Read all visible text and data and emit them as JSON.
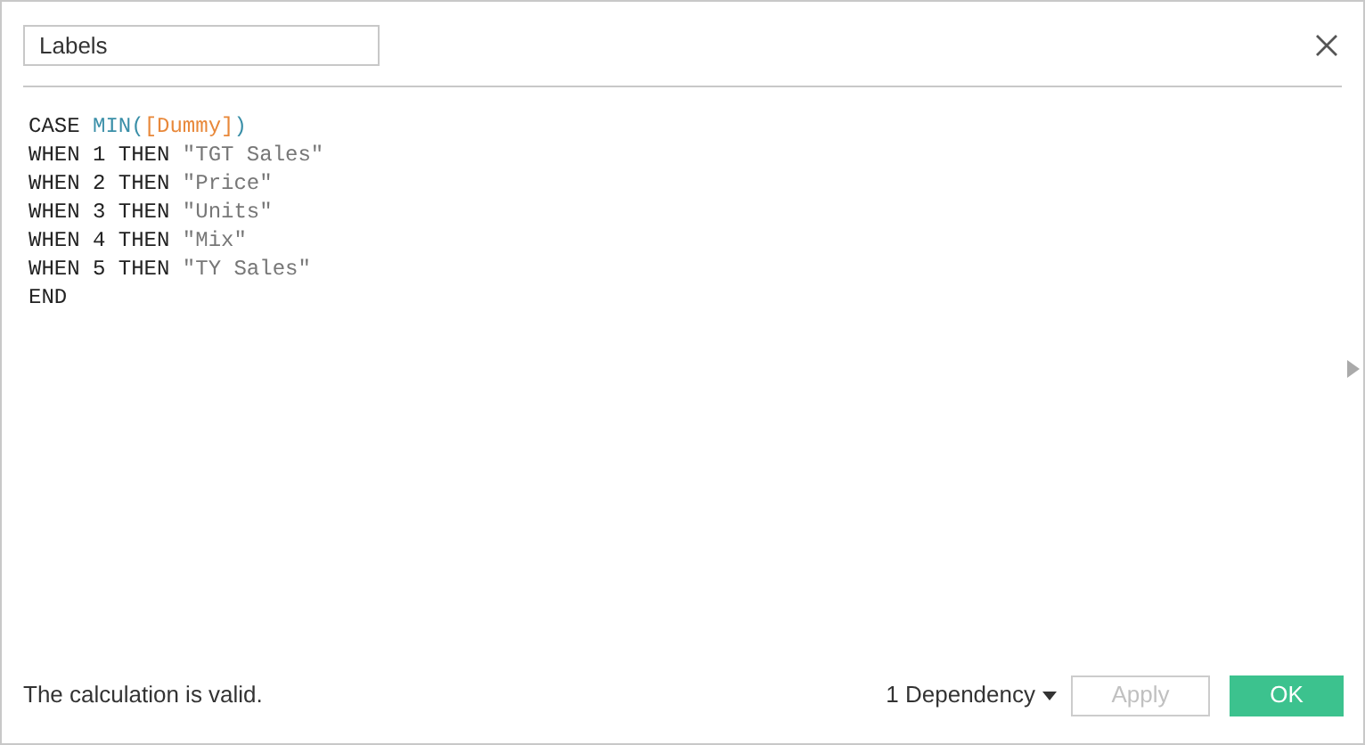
{
  "name_field": {
    "value": "Labels"
  },
  "code": {
    "lines": [
      [
        {
          "kind": "keyword",
          "text": "CASE "
        },
        {
          "kind": "function",
          "text": "MIN("
        },
        {
          "kind": "field",
          "text": "[Dummy]"
        },
        {
          "kind": "function",
          "text": ")"
        }
      ],
      [
        {
          "kind": "keyword",
          "text": "WHEN 1 THEN "
        },
        {
          "kind": "string",
          "text": "\"TGT Sales\""
        }
      ],
      [
        {
          "kind": "keyword",
          "text": "WHEN 2 THEN "
        },
        {
          "kind": "string",
          "text": "\"Price\""
        }
      ],
      [
        {
          "kind": "keyword",
          "text": "WHEN 3 THEN "
        },
        {
          "kind": "string",
          "text": "\"Units\""
        }
      ],
      [
        {
          "kind": "keyword",
          "text": "WHEN 4 THEN "
        },
        {
          "kind": "string",
          "text": "\"Mix\""
        }
      ],
      [
        {
          "kind": "keyword",
          "text": "WHEN 5 THEN "
        },
        {
          "kind": "string",
          "text": "\"TY Sales\""
        }
      ],
      [
        {
          "kind": "keyword",
          "text": "END"
        }
      ]
    ]
  },
  "status": "The calculation is valid.",
  "dependency": "1 Dependency",
  "apply": {
    "label": "Apply",
    "disabled": true
  },
  "ok": {
    "label": "OK"
  }
}
